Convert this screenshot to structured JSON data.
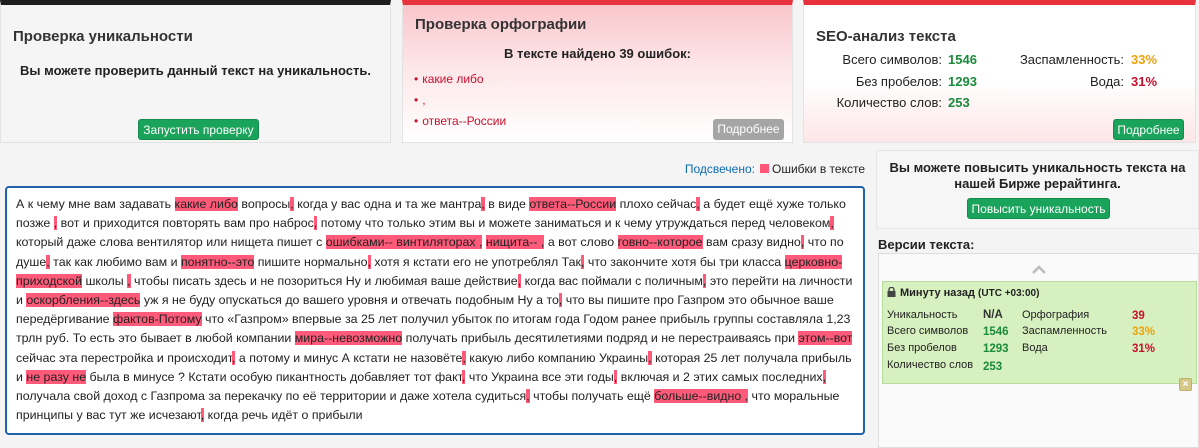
{
  "uniqueness_card": {
    "title": "Проверка уникальности",
    "message": "Вы можете проверить данный текст на уникальность.",
    "button": "Запустить проверку"
  },
  "spelling_card": {
    "title": "Проверка орфографии",
    "summary": "В тексте найдено 39 ошибок:",
    "errors": [
      "какие либо",
      ",",
      "ответа--России"
    ],
    "button": "Подробнее"
  },
  "seo_card": {
    "title": "SEO-анализ текста",
    "total_chars_label": "Всего символов:",
    "total_chars": "1546",
    "no_spaces_label": "Без пробелов:",
    "no_spaces": "1293",
    "words_label": "Количество слов:",
    "words": "253",
    "spam_label": "Заспамленность:",
    "spam": "33%",
    "water_label": "Вода:",
    "water": "31%",
    "button": "Подробнее"
  },
  "highlight_legend": {
    "label": "Подсвечено:",
    "item": "Ошибки в тексте"
  },
  "editor_segments": [
    [
      "А к чему мне вам задавать ",
      0
    ],
    [
      "какие либо",
      1
    ],
    [
      " вопросы",
      0
    ],
    [
      ",",
      1
    ],
    [
      " когда у вас одна и та же мантра",
      0
    ],
    [
      ",",
      1
    ],
    [
      " в виде ",
      0
    ],
    [
      "ответа--России",
      1
    ],
    [
      " плохо сейчас",
      0
    ],
    [
      ",",
      1
    ],
    [
      " а будет ещё хуже только позже ",
      0
    ],
    [
      ",",
      1
    ],
    [
      " вот и приходится повторять вам про наброс",
      0
    ],
    [
      ",",
      1
    ],
    [
      " потому что только этим вы и можете заниматься и к чему утруждаться перед человеком",
      0
    ],
    [
      ",",
      1
    ],
    [
      " который даже слова вентилятор или нищета пишет с ",
      0
    ],
    [
      "ошибками-- ",
      1
    ],
    [
      " ",
      0
    ],
    [
      "винтиляторах ,",
      1
    ],
    [
      " ",
      0
    ],
    [
      "нищита-- ,",
      1
    ],
    [
      " а вот слово ",
      0
    ],
    [
      "говно--которое",
      1
    ],
    [
      " вам сразу видно",
      0
    ],
    [
      ",",
      1
    ],
    [
      " что по душе",
      0
    ],
    [
      ",",
      1
    ],
    [
      " так как любимо вам и ",
      0
    ],
    [
      "понятно--это",
      1
    ],
    [
      " пишите нормально",
      0
    ],
    [
      ",",
      1
    ],
    [
      " хотя я кстати его не употреблял Так",
      0
    ],
    [
      ",",
      1
    ],
    [
      " что закончите хотя бы три класса ",
      0
    ],
    [
      "церковно-приходской",
      1
    ],
    [
      " школы ",
      0
    ],
    [
      ",",
      1
    ],
    [
      " чтобы писать здесь и не позориться Ну и любимая ваше действие",
      0
    ],
    [
      ",",
      1
    ],
    [
      " когда вас поймали с поличным",
      0
    ],
    [
      ",",
      1
    ],
    [
      " это перейти на личности и ",
      0
    ],
    [
      "оскорбления--здесь",
      1
    ],
    [
      " уж я не буду опускаться до вашего уровня и отвечать подобным Ну а то",
      0
    ],
    [
      ",",
      1
    ],
    [
      " что вы пишите про Газпром это обычное ваше передёргивание ",
      0
    ],
    [
      "фактов-Потому",
      1
    ],
    [
      " что «Газпром» впервые за 25 лет получил убыток по итогам года Годом ранее прибыль группы составляла 1,23 трлн руб. То есть это бывает в любой компании ",
      0
    ],
    [
      "мира--невозможно",
      1
    ],
    [
      " получать прибыль десятилетиями подряд и не перестраиваясь при ",
      0
    ],
    [
      "этом--вот",
      1
    ],
    [
      " сейчас эта перестройка и происходит",
      0
    ],
    [
      ",",
      1
    ],
    [
      " а потому и минус А кстати не назовёте",
      0
    ],
    [
      ",",
      1
    ],
    [
      " какую либо компанию Украины",
      0
    ],
    [
      ",",
      1
    ],
    [
      " которая 25 лет получала прибыль и ",
      0
    ],
    [
      "не разу не",
      1
    ],
    [
      " была в минусе ? Кстати особую пикантность добавляет тот факт",
      0
    ],
    [
      ",",
      1
    ],
    [
      " что Украина все эти годы",
      0
    ],
    [
      ",",
      1
    ],
    [
      " включая и 2 этих самых последних",
      0
    ],
    [
      ",",
      1
    ],
    [
      " получала свой доход с Газпрома за перекачку по её территории и даже хотела судиться",
      0
    ],
    [
      ",",
      1
    ],
    [
      " чтобы получать ещё ",
      0
    ],
    [
      "больше--видно ,",
      1
    ],
    [
      " что моральные принципы у вас тут же исчезают",
      0
    ],
    [
      ",",
      1
    ],
    [
      " когда речь идёт о прибыли",
      0
    ]
  ],
  "promo": {
    "message": "Вы можете повысить уникальность текста на нашей Бирже рерайтинга.",
    "button": "Повысить уникальность"
  },
  "versions": {
    "title": "Версии текста:",
    "item": {
      "time": "Минуту назад",
      "timezone": "(UTC +03:00)",
      "uniqueness_label": "Уникальность",
      "uniqueness": "N/A",
      "total_chars_label": "Всего символов",
      "total_chars": "1546",
      "no_spaces_label": "Без пробелов",
      "no_spaces": "1293",
      "words_label": "Количество слов",
      "words": "253",
      "spelling_label": "Орфография",
      "spelling": "39",
      "spam_label": "Заспамленность",
      "spam": "33%",
      "water_label": "Вода",
      "water": "31%"
    }
  },
  "colors": {
    "green": "#1aa35a",
    "red": "#c8102e",
    "orange": "#f0a00a",
    "highlight": "#ff5a79",
    "link_blue": "#0b6ab3"
  },
  "icons": {
    "collapse": "chevron-up-icon",
    "lock": "lock-icon",
    "dismiss": "close-icon"
  }
}
